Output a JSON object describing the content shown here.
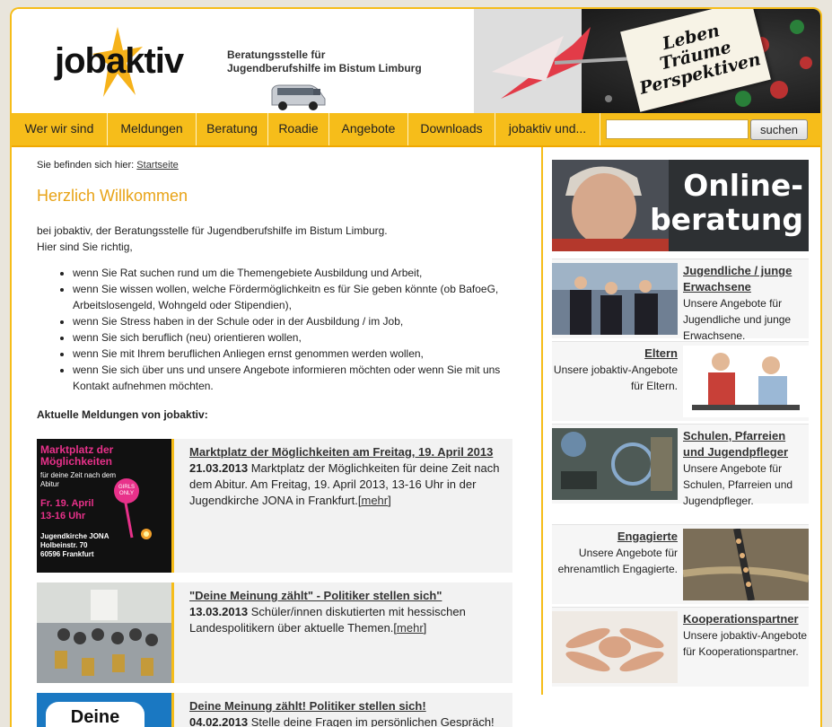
{
  "header": {
    "logo": "jobaktiv",
    "tagline_line1": "Beratungsstelle für",
    "tagline_line2": "Jugendberufshilfe im Bistum Limburg",
    "banner_words": [
      "Leben",
      "Träume",
      "Perspektiven"
    ]
  },
  "nav": {
    "items": [
      "Wer wir sind",
      "Meldungen",
      "Beratung",
      "Roadie",
      "Angebote",
      "Downloads",
      "jobaktiv und..."
    ],
    "search_placeholder": "",
    "search_button": "suchen"
  },
  "breadcrumb": {
    "prefix": "Sie befinden sich hier:",
    "link": "Startseite"
  },
  "main": {
    "title": "Herzlich Willkommen",
    "intro_line1": "bei jobaktiv, der Beratungsstelle für Jugendberufshilfe im Bistum Limburg.",
    "intro_line2": "Hier sind Sie richtig,",
    "bullets": [
      "wenn Sie Rat suchen rund um die Themengebiete Ausbildung und Arbeit,",
      "wenn Sie wissen wollen, welche Fördermöglichkeitn es für Sie geben könnte (ob BafoeG, Arbeitslosengeld, Wohngeld oder Stipendien),",
      "wenn Sie Stress haben in der Schule oder in der Ausbildung / im Job,",
      "wenn Sie sich beruflich (neu) orientieren wollen,",
      "wenn Sie mit Ihrem beruflichen Anliegen ernst genommen werden wollen,",
      "wenn Sie sich über uns und unsere Angebote informieren möchten oder wenn Sie mit uns Kontakt aufnehmen möchten."
    ],
    "news_heading": "Aktuelle Meldungen von jobaktiv:"
  },
  "news": [
    {
      "title": "Marktplatz der Möglichkeiten am Freitag, 19. April 2013",
      "date": "21.03.2013",
      "text": " Marktplatz der Möglichkeiten für deine Zeit nach dem Abitur. Am Freitag, 19. April 2013, 13-16 Uhr in der Jugendkirche JONA in Frankfurt.",
      "more": "mehr",
      "poster": {
        "headline": "Marktplatz der Möglichkeiten",
        "sub": "für deine Zeit nach dem Abitur",
        "date": "Fr. 19. April",
        "time": "13-16 Uhr",
        "badge": "GIRLS ONLY",
        "address": [
          "Jugendkirche JONA",
          "Holbeinstr. 70",
          "60596 Frankfurt"
        ]
      }
    },
    {
      "title": "\"Deine Meinung zählt\" - Politiker stellen sich\"",
      "date": "13.03.2013",
      "text": " Schüler/innen diskutierten mit hessischen Landespolitikern über aktuelle Themen.",
      "more": "mehr"
    },
    {
      "title": "Deine Meinung zählt! Politiker stellen sich!",
      "date": "04.02.2013",
      "text": " Stelle deine Fragen im persönlichen Gespräch!",
      "thumb_text": "Deine"
    }
  ],
  "sidebar": {
    "online_line1": "Online-",
    "online_line2": "beratung",
    "items": [
      {
        "title": "Jugendliche / junge Erwachsene",
        "text": "Unsere Angebote für Jugendliche und junge Erwachsene."
      },
      {
        "title": "Eltern",
        "text": "Unsere jobaktiv-Angebote für Eltern."
      },
      {
        "title": "Schulen, Pfarreien und Jugendpfleger",
        "text": "Unsere Angebote für Schulen, Pfarreien und Jugendpfleger."
      },
      {
        "title": "Engagierte",
        "text": "Unsere Angebote für ehrenamtlich Engagierte."
      },
      {
        "title": "Kooperationspartner",
        "text": "Unsere jobaktiv-Angebote für Kooperationspartner."
      }
    ]
  },
  "colors": {
    "accent": "#f6bd1a",
    "title": "#e8a317",
    "banner_dark": "#2d3033"
  }
}
